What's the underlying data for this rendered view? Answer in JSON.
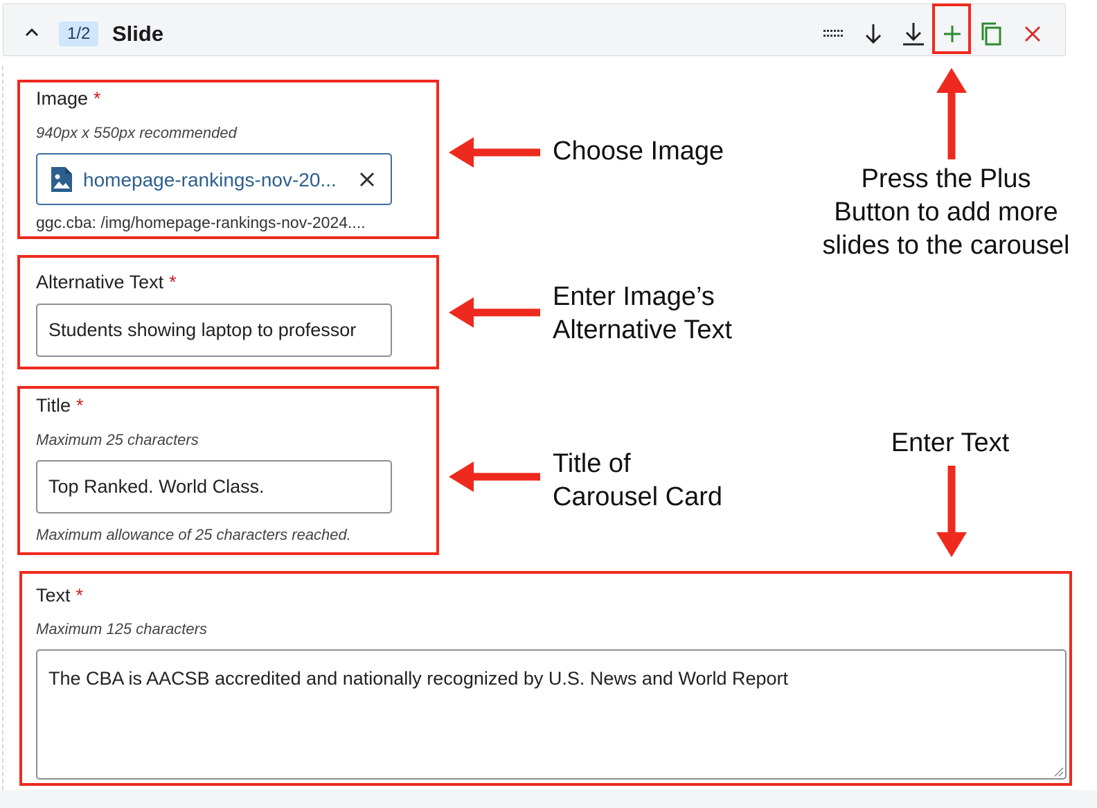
{
  "header": {
    "counter": "1/2",
    "title": "Slide"
  },
  "fields": {
    "image": {
      "label": "Image",
      "required": "*",
      "help": "940px x 550px recommended",
      "file_name": "homepage-rankings-nov-20...",
      "path": "ggc.cba: /img/homepage-rankings-nov-2024...."
    },
    "alt_text": {
      "label": "Alternative Text",
      "required": "*",
      "value": "Students showing laptop to professor"
    },
    "title": {
      "label": "Title",
      "required": "*",
      "help": "Maximum 25 characters",
      "value": "Top Ranked. World Class.",
      "status": "Maximum allowance of 25 characters reached."
    },
    "text": {
      "label": "Text",
      "required": "*",
      "help": "Maximum 125 characters",
      "value": "The CBA is AACSB accredited and nationally recognized by U.S. News and World Report"
    }
  },
  "annotations": {
    "choose_image": "Choose Image",
    "alt_text_line1": "Enter Image’s",
    "alt_text_line2": "Alternative Text",
    "title_line1": "Title of",
    "title_line2": "Carousel Card",
    "plus_line1": "Press the Plus",
    "plus_line2": "Button to add more",
    "plus_line3": "slides to the carousel",
    "enter_text": "Enter Text"
  },
  "colors": {
    "annotation_red": "#ee2a1e",
    "required_red": "#d01e1e",
    "add_green": "#2e8b2e",
    "delete_red": "#d32f2f",
    "link_blue": "#2c5f8f",
    "counter_bg": "#cfe6fb"
  },
  "icons": [
    "chevron-up-icon",
    "drag-handle-icon",
    "move-down-icon",
    "move-to-bottom-icon",
    "add-icon",
    "duplicate-icon",
    "delete-icon",
    "image-file-icon",
    "clear-icon",
    "resize-grip-icon",
    "arrow-icon"
  ]
}
